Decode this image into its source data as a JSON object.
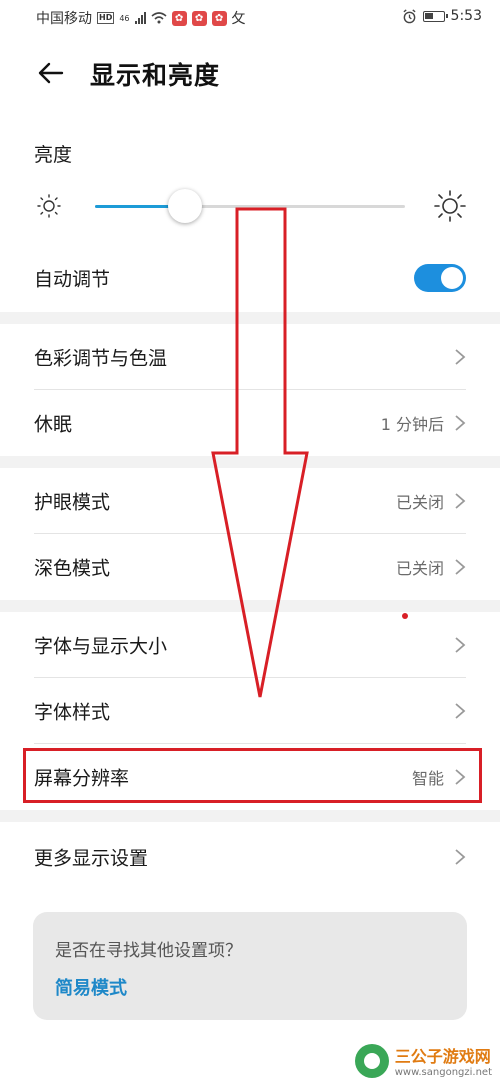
{
  "status_bar": {
    "carrier": "中国移动",
    "hd": "HD",
    "net": "46",
    "time": "5:53",
    "extra_glyph": "攵"
  },
  "header": {
    "title": "显示和亮度"
  },
  "brightness": {
    "label": "亮度",
    "level": 0.29
  },
  "auto_adjust": {
    "label": "自动调节",
    "enabled": true
  },
  "groups": [
    {
      "items": [
        {
          "label": "色彩调节与色温",
          "value": ""
        },
        {
          "label": "休眠",
          "value": "1 分钟后"
        }
      ]
    },
    {
      "items": [
        {
          "label": "护眼模式",
          "value": "已关闭"
        },
        {
          "label": "深色模式",
          "value": "已关闭"
        }
      ]
    },
    {
      "items": [
        {
          "label": "字体与显示大小",
          "value": ""
        },
        {
          "label": "字体样式",
          "value": ""
        },
        {
          "label": "屏幕分辨率",
          "value": "智能"
        }
      ]
    },
    {
      "items": [
        {
          "label": "更多显示设置",
          "value": ""
        }
      ]
    }
  ],
  "suggestion": {
    "question": "是否在寻找其他设置项？",
    "link": "简易模式"
  },
  "watermark": {
    "title": "三公子游戏网",
    "url": "www.sangongzi.net"
  },
  "colors": {
    "accent": "#1d8fde",
    "annotation": "#d81f26"
  }
}
